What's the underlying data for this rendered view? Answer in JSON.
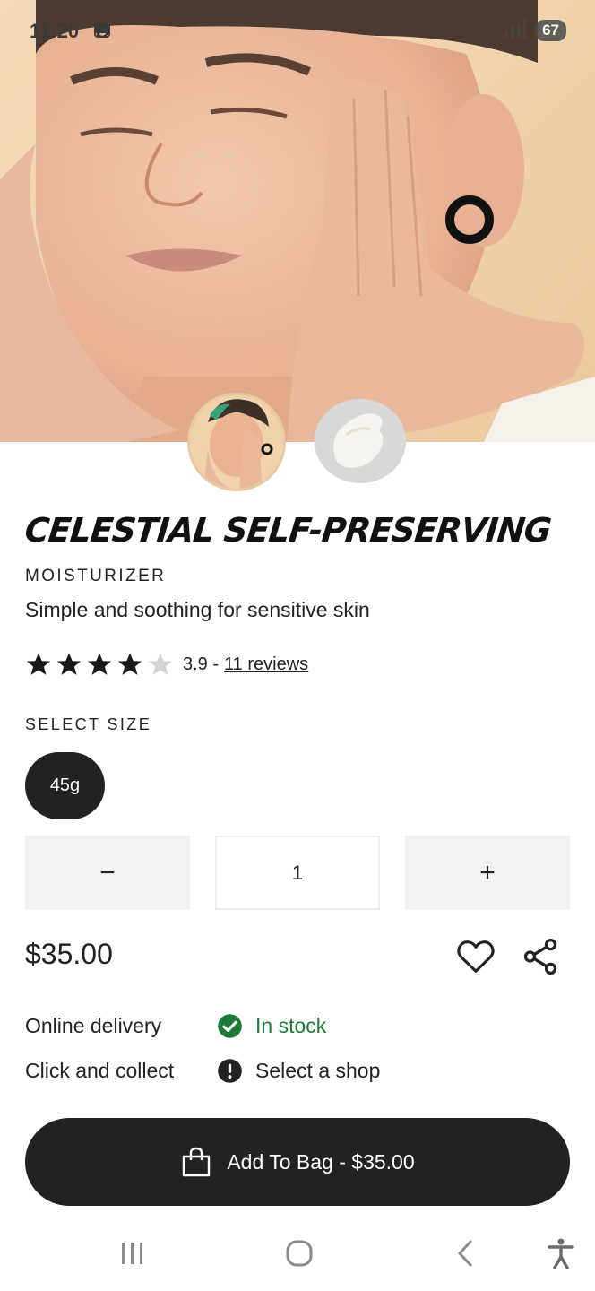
{
  "status_bar": {
    "time": "11:20",
    "battery": "67"
  },
  "thumbnails": [
    "model-photo",
    "product-texture-photo"
  ],
  "product": {
    "title": "CELESTIAL SELF-PRESERVING",
    "category": "MOISTURIZER",
    "subtitle": "Simple and soothing for sensitive skin",
    "rating": 3.9,
    "rating_text": "3.9 -",
    "reviews_link": "11 reviews",
    "stars_total": 5
  },
  "size": {
    "label": "SELECT SIZE",
    "options": [
      "45g"
    ],
    "selected": "45g"
  },
  "quantity": {
    "minus": "−",
    "value": "1",
    "plus": "+"
  },
  "price": "$35.00",
  "availability": [
    {
      "label": "Online delivery",
      "status": "In stock",
      "icon": "check-circle-icon",
      "color": "#1d7a3a"
    },
    {
      "label": "Click and collect",
      "status": "Select a shop",
      "icon": "exclamation-circle-icon",
      "color": "#222222"
    }
  ],
  "add_to_bag": {
    "label": "Add To Bag - $35.00",
    "icon": "shopping-bag-icon"
  },
  "colors": {
    "primary": "#222222",
    "in_stock": "#1d7a3a",
    "qty_bg": "#f2f2f2"
  },
  "nav": [
    "recent-apps-icon",
    "home-icon",
    "back-icon",
    "accessibility-icon"
  ]
}
